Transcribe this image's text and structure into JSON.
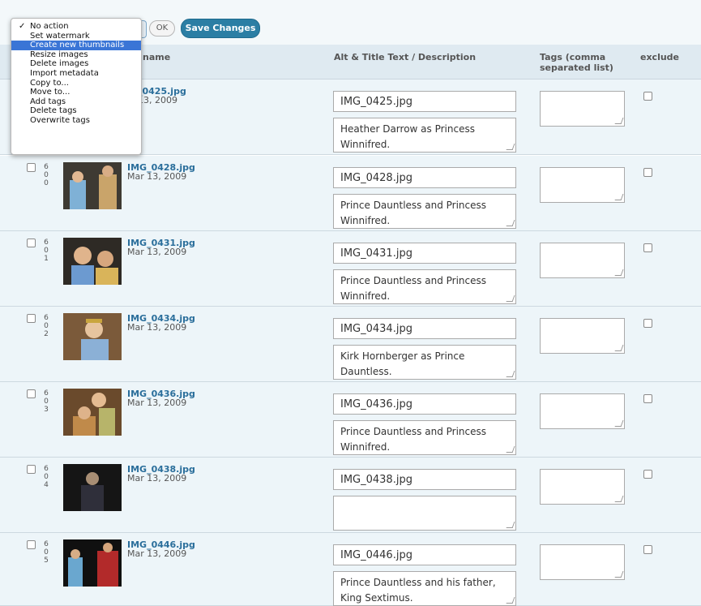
{
  "toolbar": {
    "ok_label": "OK",
    "save_label": "Save Changes"
  },
  "bulk_menu": {
    "items": [
      {
        "label": "No action",
        "checked": true,
        "highlighted": false
      },
      {
        "label": "Set watermark",
        "checked": false,
        "highlighted": false
      },
      {
        "label": "Create new thumbnails",
        "checked": false,
        "highlighted": true
      },
      {
        "label": "Resize images",
        "checked": false,
        "highlighted": false
      },
      {
        "label": "Delete images",
        "checked": false,
        "highlighted": false
      },
      {
        "label": "Import metadata",
        "checked": false,
        "highlighted": false
      },
      {
        "label": "Copy to...",
        "checked": false,
        "highlighted": false
      },
      {
        "label": "Move to...",
        "checked": false,
        "highlighted": false
      },
      {
        "label": "Add tags",
        "checked": false,
        "highlighted": false
      },
      {
        "label": "Delete tags",
        "checked": false,
        "highlighted": false
      },
      {
        "label": "Overwrite tags",
        "checked": false,
        "highlighted": false
      }
    ],
    "check_mark": "✓"
  },
  "table": {
    "headers": {
      "filename_partial": "name",
      "alt": "Alt & Title Text / Description",
      "tags": "Tags (comma separated list)",
      "exclude": "exclude"
    },
    "rows": [
      {
        "id": "",
        "filename": "IMG_0425.jpg",
        "filename_visible": "_0425.jpg",
        "date": "Mar 13, 2009",
        "date_visible": "13, 2009",
        "title": "IMG_0425.jpg",
        "description": "Heather Darrow as Princess Winnifred.",
        "tags": ""
      },
      {
        "id": "600",
        "filename": "IMG_0428.jpg",
        "date": "Mar 13, 2009",
        "title": "IMG_0428.jpg",
        "description": "Prince Dauntless and Princess Winnifred.",
        "tags": ""
      },
      {
        "id": "601",
        "filename": "IMG_0431.jpg",
        "date": "Mar 13, 2009",
        "title": "IMG_0431.jpg",
        "description": "Prince Dauntless and Princess Winnifred.",
        "tags": ""
      },
      {
        "id": "602",
        "filename": "IMG_0434.jpg",
        "date": "Mar 13, 2009",
        "title": "IMG_0434.jpg",
        "description": "Kirk Hornberger as Prince Dauntless.",
        "tags": ""
      },
      {
        "id": "603",
        "filename": "IMG_0436.jpg",
        "date": "Mar 13, 2009",
        "title": "IMG_0436.jpg",
        "description": "Prince Dauntless and Princess Winnifred.",
        "tags": ""
      },
      {
        "id": "604",
        "filename": "IMG_0438.jpg",
        "date": "Mar 13, 2009",
        "title": "IMG_0438.jpg",
        "description": "",
        "tags": ""
      },
      {
        "id": "605",
        "filename": "IMG_0446.jpg",
        "date": "Mar 13, 2009",
        "title": "IMG_0446.jpg",
        "description": "Prince Dauntless and his father, King Sextimus.",
        "tags": ""
      }
    ]
  },
  "colors": {
    "accent": "#2b7ea4",
    "row_bg": "#edf5f9",
    "header_bg": "#dfeaf1",
    "menu_highlight": "#3a75d6",
    "link": "#2a6e9b"
  }
}
